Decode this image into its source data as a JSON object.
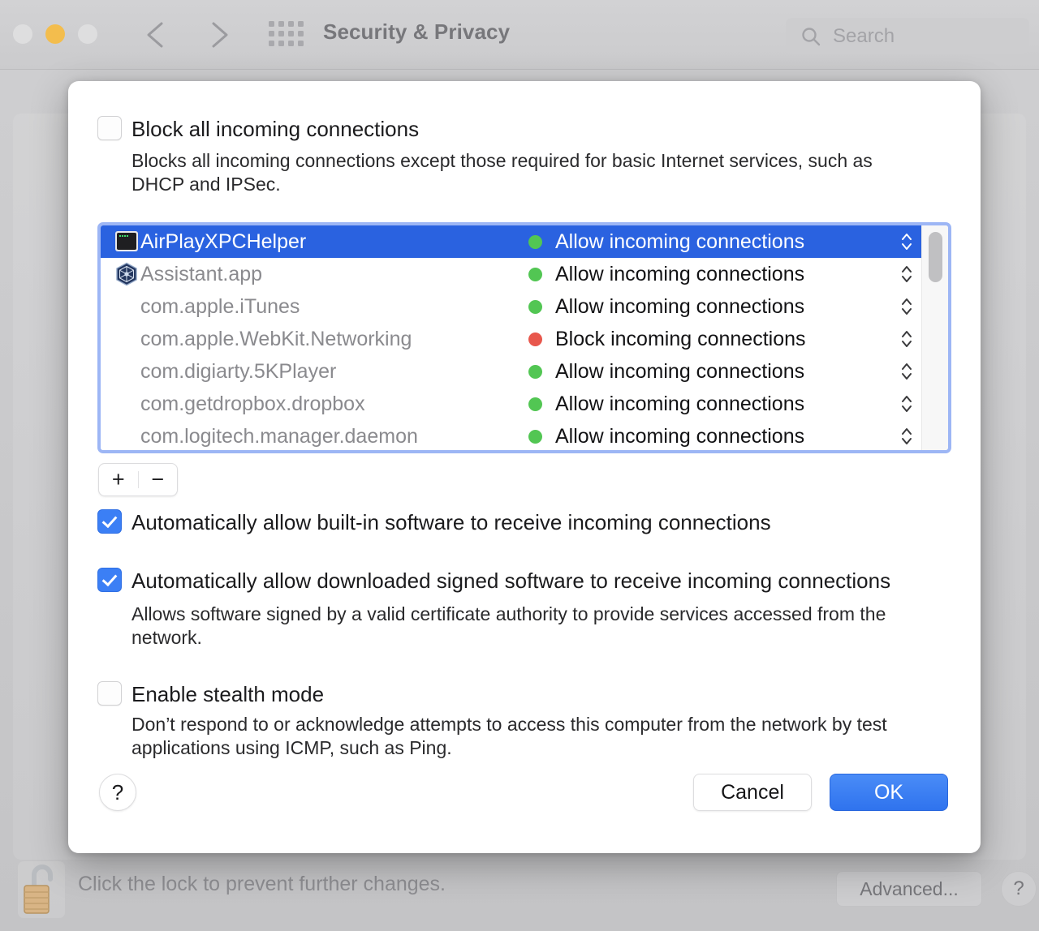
{
  "window": {
    "title": "Security & Privacy",
    "traffic_lights": [
      "close",
      "minimize",
      "zoom"
    ],
    "nav": {
      "back": "back-chevron",
      "forward": "forward-chevron"
    },
    "grid_icon": "grid-icon",
    "search": {
      "placeholder": "Search",
      "icon": "search-icon"
    },
    "accent_blue": "#2a62e0",
    "allow_green": "#52c653",
    "block_red": "#e8574c"
  },
  "footer": {
    "lock_icon": "unlocked-padlock-icon",
    "lock_text": "Click the lock to prevent further changes.",
    "advanced_label": "Advanced...",
    "help_label": "?"
  },
  "sheet": {
    "block_all": {
      "label": "Block all incoming connections",
      "checked": false,
      "description": "Blocks all incoming connections except those required for basic Internet services, such as DHCP and IPSec."
    },
    "app_list": {
      "rows": [
        {
          "name": "AirPlayXPCHelper",
          "icon": "terminal-icon",
          "status": "Allow incoming connections",
          "state": "allow",
          "selected": true
        },
        {
          "name": "Assistant.app",
          "icon": "assistant-hexagon-icon",
          "status": "Allow incoming connections",
          "state": "allow",
          "selected": false
        },
        {
          "name": "com.apple.iTunes",
          "icon": "",
          "status": "Allow incoming connections",
          "state": "allow",
          "selected": false
        },
        {
          "name": "com.apple.WebKit.Networking",
          "icon": "",
          "status": "Block incoming connections",
          "state": "block",
          "selected": false
        },
        {
          "name": "com.digiarty.5KPlayer",
          "icon": "",
          "status": "Allow incoming connections",
          "state": "allow",
          "selected": false
        },
        {
          "name": "com.getdropbox.dropbox",
          "icon": "",
          "status": "Allow incoming connections",
          "state": "allow",
          "selected": false
        },
        {
          "name": "com.logitech.manager.daemon",
          "icon": "",
          "status": "Allow incoming connections",
          "state": "allow",
          "selected": false
        }
      ]
    },
    "add_label": "+",
    "remove_label": "−",
    "auto_builtin": {
      "label": "Automatically allow built-in software to receive incoming connections",
      "checked": true
    },
    "auto_signed": {
      "label": "Automatically allow downloaded signed software to receive incoming connections",
      "checked": true,
      "description": "Allows software signed by a valid certificate authority to provide services accessed from the network."
    },
    "stealth": {
      "label": "Enable stealth mode",
      "checked": false,
      "description": "Don’t respond to or acknowledge attempts to access this computer from the network by test applications using ICMP, such as Ping."
    },
    "help_label": "?",
    "cancel_label": "Cancel",
    "ok_label": "OK"
  }
}
